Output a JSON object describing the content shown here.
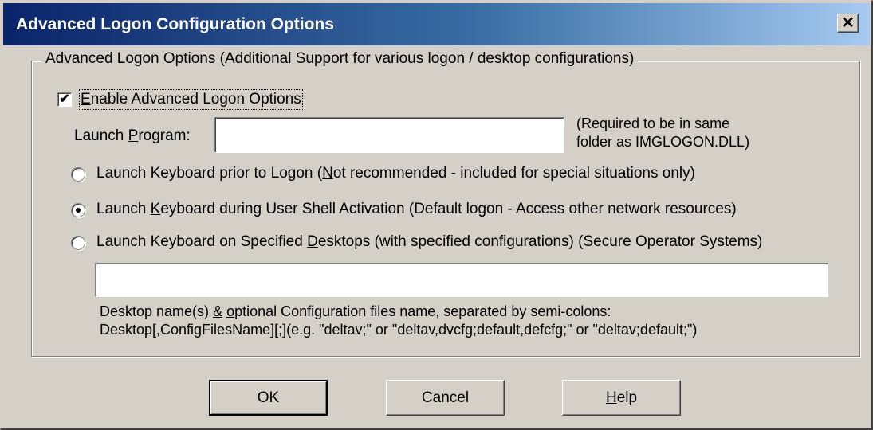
{
  "window": {
    "title": "Advanced Logon Configuration Options",
    "close_glyph": "✕"
  },
  "group": {
    "legend": "Advanced Logon Options (Additional Support for various logon / desktop configurations)"
  },
  "enable_checkbox": {
    "label_pre": "",
    "label_accel": "E",
    "label_post": "nable Advanced Logon Options",
    "checked": true,
    "check_glyph": "✔"
  },
  "launch_program": {
    "label_pre": "Launch ",
    "label_accel": "P",
    "label_post": "rogram:",
    "value": "",
    "note_line1": "(Required to be in same",
    "note_line2": "folder as IMGLOGON.DLL)"
  },
  "radios": [
    {
      "label_pre": "Launch Keyboard prior to Logon (",
      "label_accel": "N",
      "label_post": "ot recommended - included for special situations only)",
      "selected": false
    },
    {
      "label_pre": "Launch ",
      "label_accel": "K",
      "label_post": "eyboard during User Shell Activation (Default logon - Access other network resources)",
      "selected": true
    },
    {
      "label_pre": "Launch Keyboard on Specified ",
      "label_accel": "D",
      "label_post": "esktops (with specified configurations) (Secure Operator Systems)",
      "selected": false
    }
  ],
  "desktops_field": {
    "value": "",
    "help_line1_pre": "Desktop name(s) ",
    "help_line1_accel": "&",
    "help_line1_mid": " ",
    "help_line1_accel2": "o",
    "help_line1_post": "ptional Configuration files name, separated by semi-colons:",
    "help_line2": "Desktop[,ConfigFilesName][;](e.g. \"deltav;\" or \"deltav,dvcfg;default,defcfg;\" or \"deltav;default;\")"
  },
  "buttons": {
    "ok": "OK",
    "cancel": "Cancel",
    "help_accel": "H",
    "help_post": "elp"
  }
}
